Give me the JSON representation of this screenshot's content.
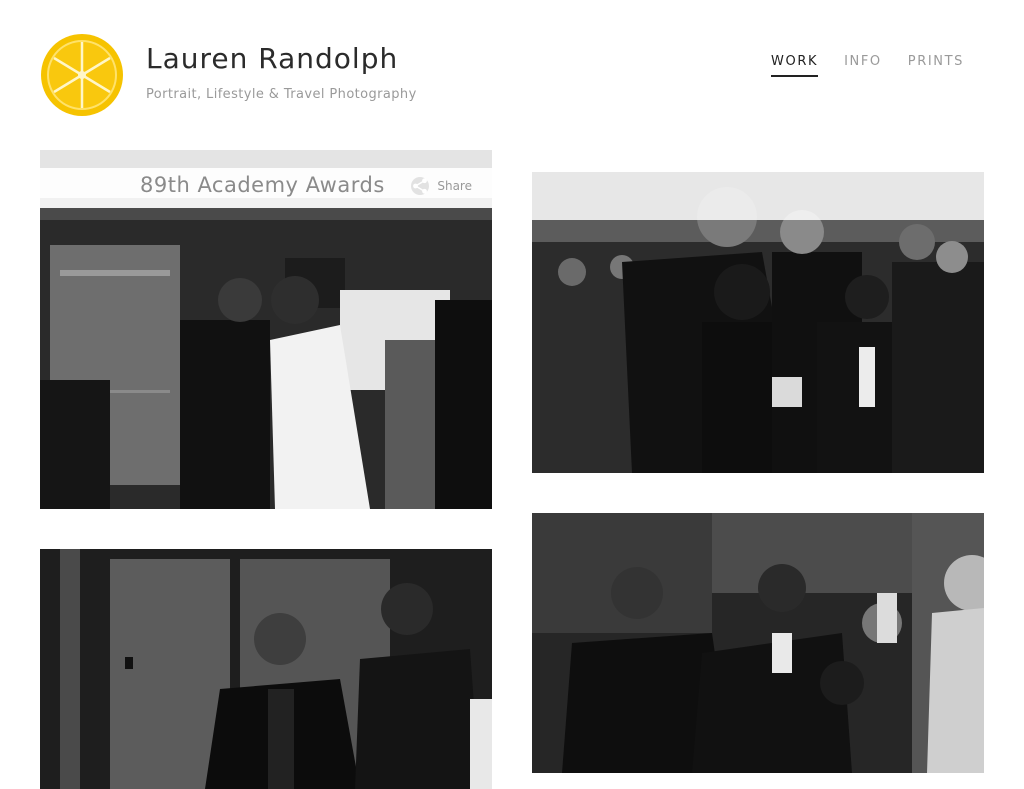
{
  "header": {
    "logo_icon": "lemon-slice-logo-icon",
    "title": "Lauren Randolph",
    "tagline": "Portrait, Lifestyle & Travel Photography"
  },
  "nav": {
    "items": [
      {
        "label": "WORK",
        "active": true
      },
      {
        "label": "INFO",
        "active": false
      },
      {
        "label": "PRINTS",
        "active": false
      }
    ]
  },
  "gallery": {
    "caption": "89th Academy Awards",
    "share_label": "Share",
    "share_icon": "share-icon",
    "photos": [
      {
        "name": "photo-embrace-elevator"
      },
      {
        "name": "photo-group-hug-crowd"
      },
      {
        "name": "photo-surprised-elevator"
      },
      {
        "name": "photo-celebration-backstage"
      }
    ]
  },
  "colors": {
    "logo_yellow": "#F6C300",
    "nav_active": "#222222",
    "nav_inactive": "#9A9A9A",
    "tagline": "#9A9A9A"
  }
}
